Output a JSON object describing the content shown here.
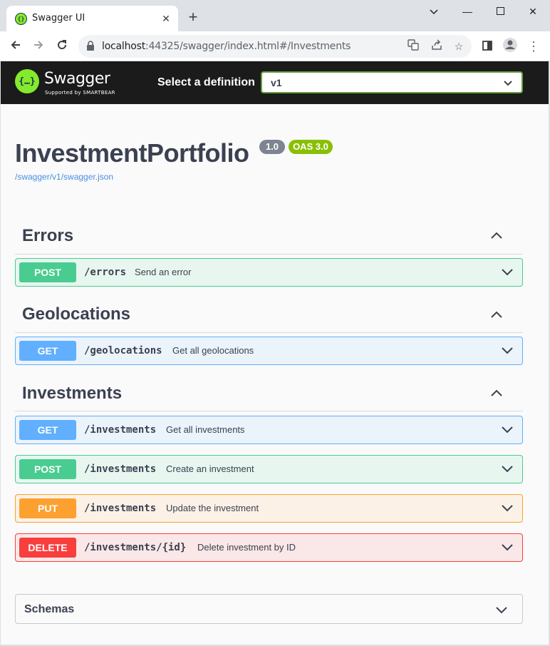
{
  "browser": {
    "tab_title": "Swagger UI",
    "url_host": "localhost",
    "url_rest": ":44325/swagger/index.html#/Investments"
  },
  "header": {
    "logo_text": "Swagger",
    "logo_subtext": "Supported by SMARTBEAR",
    "definition_label": "Select a definition",
    "definition_value": "v1"
  },
  "info": {
    "title": "InvestmentPortfolio",
    "version": "1.0",
    "oas": "OAS 3.0",
    "spec_link": "/swagger/v1/swagger.json"
  },
  "sections": [
    {
      "name": "Errors",
      "operations": [
        {
          "method": "POST",
          "path": "/errors",
          "summary": "Send an error"
        }
      ]
    },
    {
      "name": "Geolocations",
      "operations": [
        {
          "method": "GET",
          "path": "/geolocations",
          "summary": "Get all geolocations"
        }
      ]
    },
    {
      "name": "Investments",
      "operations": [
        {
          "method": "GET",
          "path": "/investments",
          "summary": "Get all investments"
        },
        {
          "method": "POST",
          "path": "/investments",
          "summary": "Create an investment"
        },
        {
          "method": "PUT",
          "path": "/investments",
          "summary": "Update the investment"
        },
        {
          "method": "DELETE",
          "path": "/investments/{id}",
          "summary": "Delete investment by ID"
        }
      ]
    }
  ],
  "schemas_label": "Schemas",
  "colors": {
    "post": "#49cc90",
    "get": "#61affe",
    "put": "#fca130",
    "delete": "#f93e3e",
    "brand": "#85ea2d"
  }
}
